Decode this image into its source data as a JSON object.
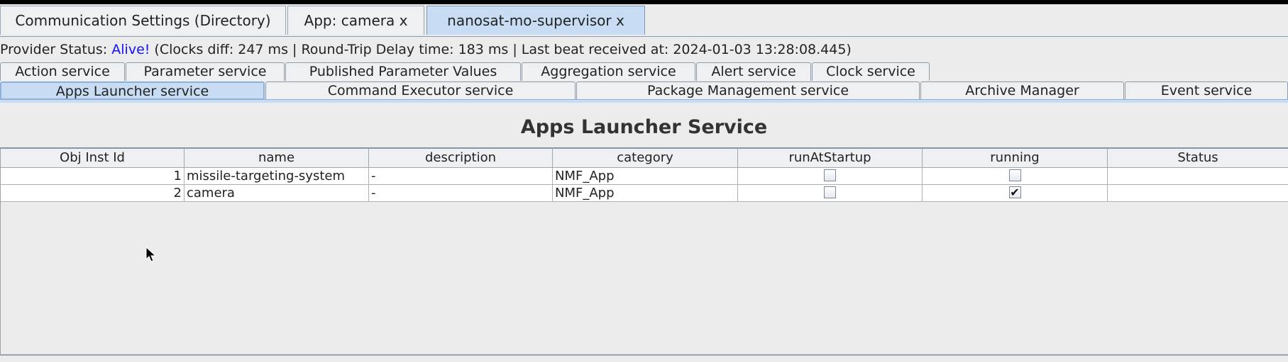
{
  "top_tabs": [
    {
      "label": "Communication Settings (Directory)",
      "active": false
    },
    {
      "label": "App: camera x",
      "active": false
    },
    {
      "label": "nanosat-mo-supervisor x",
      "active": true
    }
  ],
  "status": {
    "prefix": "Provider Status: ",
    "alive": "Alive!",
    "details": " (Clocks diff: 247 ms | Round-Trip Delay time: 183 ms | Last beat received at: 2024-01-03 13:28:08.445)"
  },
  "service_tabs_row1": [
    {
      "label": "Action service"
    },
    {
      "label": "Parameter service"
    },
    {
      "label": "Published Parameter Values"
    },
    {
      "label": "Aggregation service"
    },
    {
      "label": "Alert service"
    },
    {
      "label": "Clock service"
    }
  ],
  "service_tabs_row2": [
    {
      "label": "Apps Launcher service",
      "active": true
    },
    {
      "label": "Command Executor service"
    },
    {
      "label": "Package Management service"
    },
    {
      "label": "Archive Manager"
    },
    {
      "label": "Event service"
    }
  ],
  "panel": {
    "title": "Apps Launcher Service"
  },
  "table": {
    "columns": [
      "Obj Inst Id",
      "name",
      "description",
      "category",
      "runAtStartup",
      "running",
      "Status"
    ],
    "rows": [
      {
        "id": "1",
        "name": "missile-targeting-system",
        "description": "-",
        "category": "NMF_App",
        "runAtStartup": false,
        "running": false,
        "status": ""
      },
      {
        "id": "2",
        "name": "camera",
        "description": "-",
        "category": "NMF_App",
        "runAtStartup": false,
        "running": true,
        "status": ""
      }
    ]
  },
  "icons": {
    "check_glyph": "✔",
    "cursor": "mouse-pointer-icon"
  }
}
